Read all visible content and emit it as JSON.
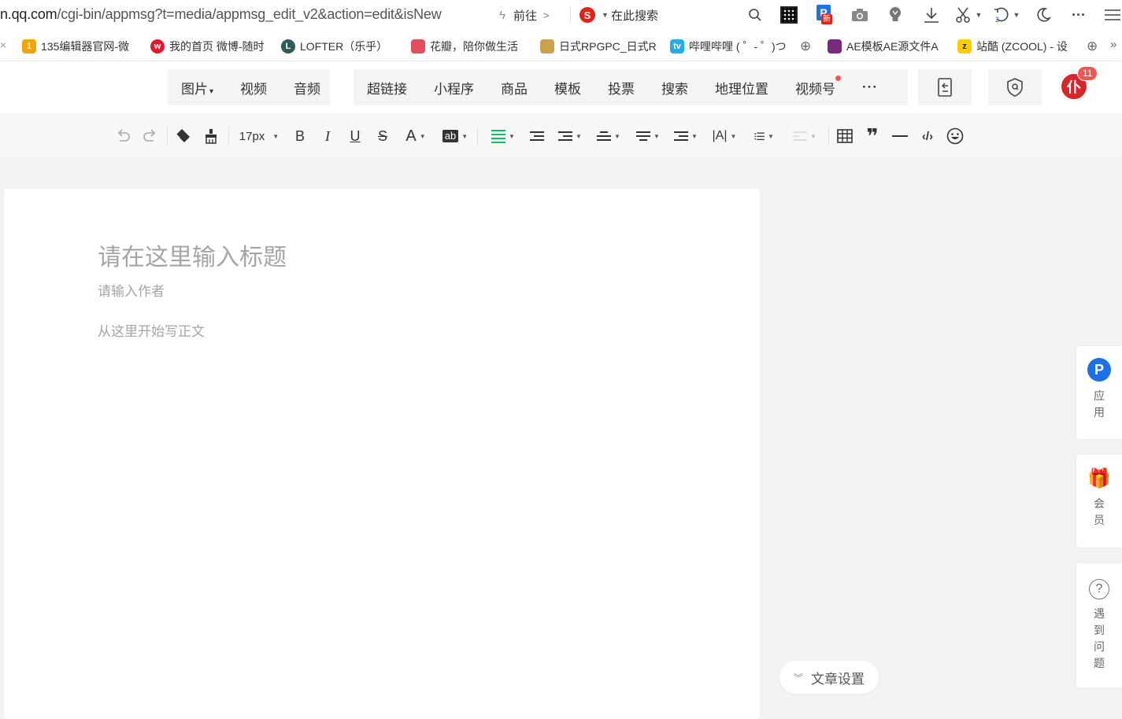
{
  "browser": {
    "url_host": "n.qq.com",
    "url_path": "/cgi-bin/appmsg?t=media/appmsg_edit_v2&action=edit&isNew",
    "goto_label": "前往",
    "search_placeholder": "在此搜索",
    "undo_count": "2",
    "new_badge": "新",
    "p_letter": "P"
  },
  "bookmarks": [
    {
      "label": "135编辑器官网-微",
      "icon": "135-icon",
      "color": "#f4a400"
    },
    {
      "label": "我的首页 微博-随时",
      "icon": "weibo-icon",
      "color": "#e6162d"
    },
    {
      "label": "LOFTER（乐乎）",
      "icon": "lofter-icon",
      "color": "#315b5b"
    },
    {
      "label": "花瓣，陪你做生活",
      "icon": "huaban-icon",
      "color": "#e54d5f"
    },
    {
      "label": "日式RPGPC_日式R",
      "icon": "rpg-icon",
      "color": "#c9a24a"
    },
    {
      "label": "哔哩哔哩 ( ゜- ゜)つ",
      "icon": "bilibili-icon",
      "color": "#23ade5"
    },
    {
      "label": "AE模板AE源文件A",
      "icon": "ae-icon",
      "color": "#7a2a7e"
    },
    {
      "label": "站酷 (ZCOOL) - 设",
      "icon": "zcool-icon",
      "color": "#ffcc00"
    }
  ],
  "insert_tabs": {
    "media": [
      "图片",
      "视频",
      "音频"
    ],
    "media_dropdown_index": 0,
    "features": [
      "超链接",
      "小程序",
      "商品",
      "模板",
      "投票",
      "搜索",
      "地理位置",
      "视频号"
    ],
    "more_label": "···",
    "notification_count": "11"
  },
  "format": {
    "font_size": "17px",
    "bold": "B",
    "italic": "I",
    "underline": "U",
    "strike": "S",
    "font_color": "A",
    "highlight": "ab",
    "letter_spacing": "|A|",
    "accent_color": "#07c160"
  },
  "editor": {
    "title_placeholder": "请在这里输入标题",
    "author_placeholder": "请输入作者",
    "body_placeholder": "从这里开始写正文",
    "settings_label": "文章设置"
  },
  "side_panels": {
    "apps_label": "应用",
    "member_label": "会员",
    "help_label": "遇到问题",
    "apps_letter": "P",
    "help_symbol": "?"
  }
}
